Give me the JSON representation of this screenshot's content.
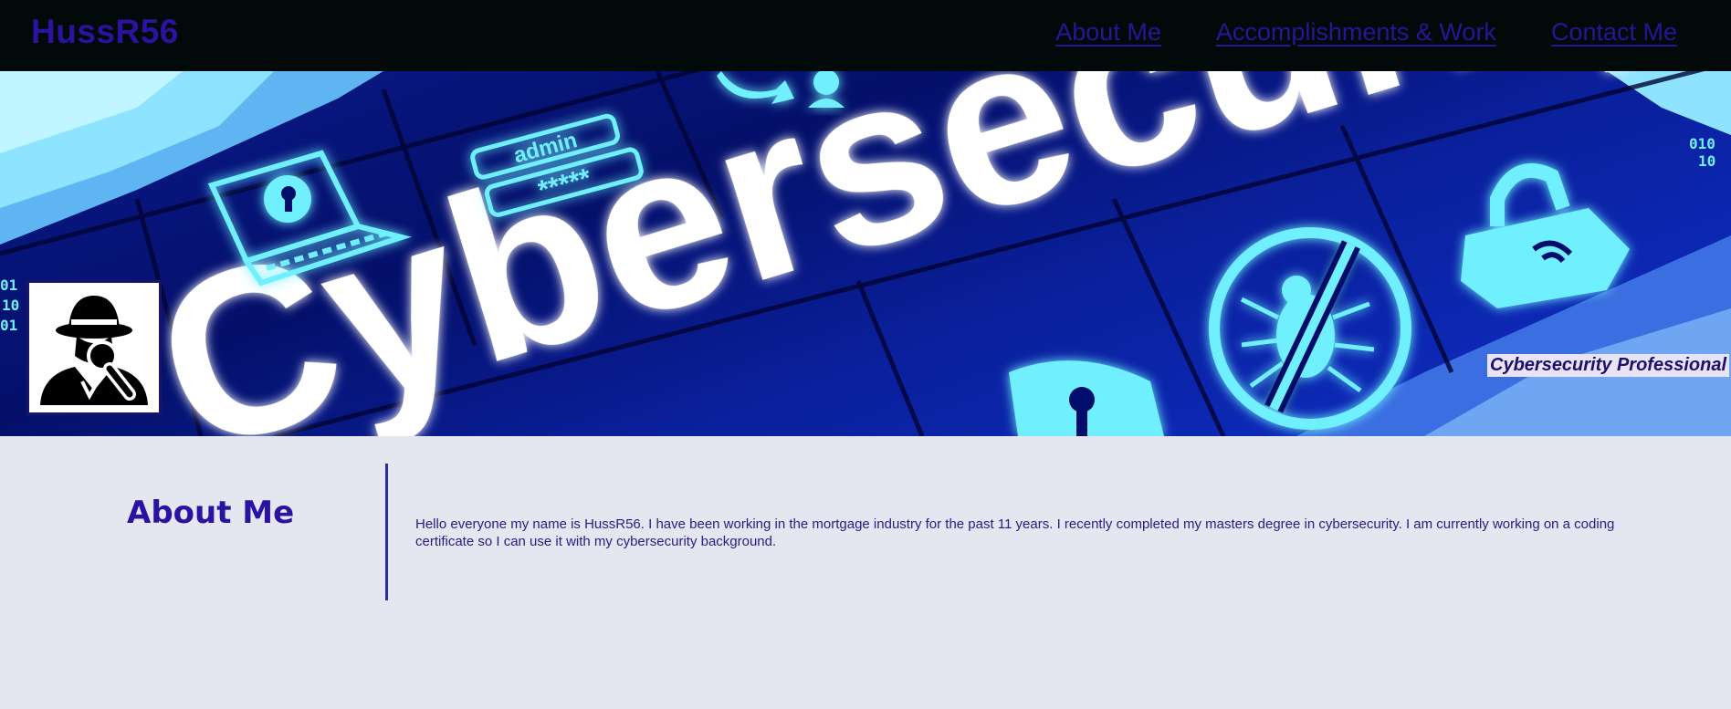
{
  "nav": {
    "logo": "HussR56",
    "links": [
      "About Me",
      "Accomplishments & Work",
      "Contact Me"
    ]
  },
  "hero": {
    "banner_text": "Cybersecurity",
    "admin_label": "admin",
    "password_mask": "*****",
    "tagline": "Cybersecurity Professional",
    "icons": [
      "laptop-lock-icon",
      "login-icon",
      "user-sync-icon",
      "padlock-wifi-icon",
      "no-bug-icon",
      "shield-keyhole-icon"
    ]
  },
  "about": {
    "heading": "About Me",
    "text": "Hello everyone my name is HussR56. I have been working in the mortgage industry for the past 11 years. I recently completed my masters degree in cybersecurity. I am currently working on a coding certificate so I can use it with my cybersecurity background."
  },
  "colors": {
    "nav_bg": "#020a09",
    "accent": "#2b12a0",
    "page_bg": "#e4e7ef",
    "glow": "#6ff0ff"
  }
}
